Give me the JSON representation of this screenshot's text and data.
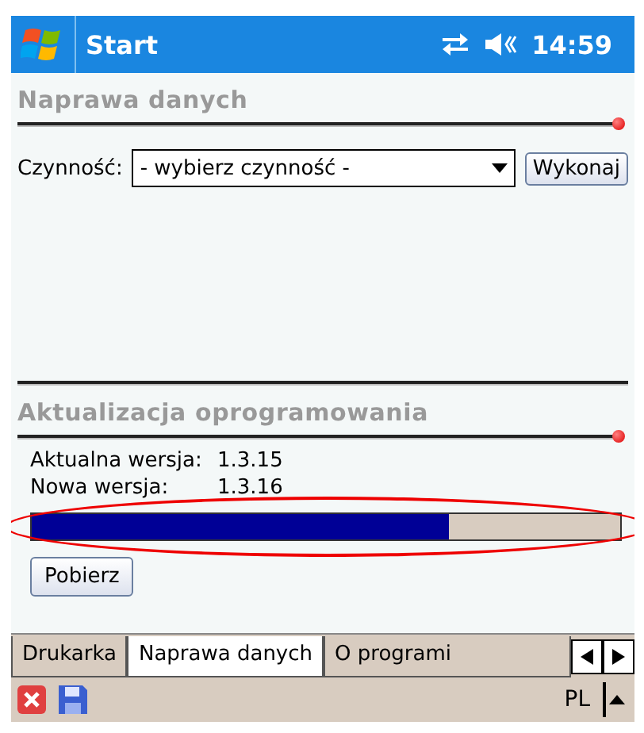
{
  "title_bar": {
    "title": "Start",
    "time": "14:59"
  },
  "repair_section": {
    "heading": "Naprawa danych",
    "action_label": "Czynność:",
    "action_select": {
      "value": "- wybierz czynność -"
    },
    "run_button": "Wykonaj"
  },
  "update_section": {
    "heading": "Aktualizacja oprogramowania",
    "versions": [
      {
        "label": "Aktualna wersja:",
        "value": "1.3.15"
      },
      {
        "label": "Nowa wersja:",
        "value": "1.3.16"
      }
    ],
    "progress": {
      "level": 0.71
    },
    "download_button": "Pobierz"
  },
  "tabs": [
    {
      "label": "Drukarka",
      "selected": false
    },
    {
      "label": "Naprawa danych",
      "selected": true
    },
    {
      "label": "O programi",
      "selected": false
    }
  ],
  "menu_bar": {
    "input_mode": "PL"
  }
}
